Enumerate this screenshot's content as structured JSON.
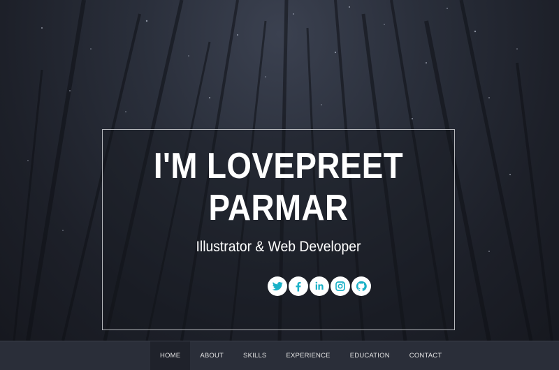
{
  "hero": {
    "name": "I'M LOVEPREET PARMAR",
    "role": "Illustrator & Web Developer",
    "socials": [
      {
        "icon": "twitter-icon",
        "label": "Twitter"
      },
      {
        "icon": "facebook-icon",
        "label": "Facebook"
      },
      {
        "icon": "linkedin-icon",
        "label": "LinkedIn"
      },
      {
        "icon": "instagram-icon",
        "label": "Instagram"
      },
      {
        "icon": "github-icon",
        "label": "GitHub"
      }
    ]
  },
  "nav": {
    "items": [
      {
        "label": "HOME",
        "active": true
      },
      {
        "label": "ABOUT",
        "active": false
      },
      {
        "label": "SKILLS",
        "active": false
      },
      {
        "label": "EXPERIENCE",
        "active": false
      },
      {
        "label": "EDUCATION",
        "active": false
      },
      {
        "label": "CONTACT",
        "active": false
      }
    ]
  },
  "colors": {
    "accent": "#1ab1c7",
    "nav_bg": "#2a2e39",
    "nav_active_bg": "#1f222b",
    "text": "#ffffff"
  }
}
